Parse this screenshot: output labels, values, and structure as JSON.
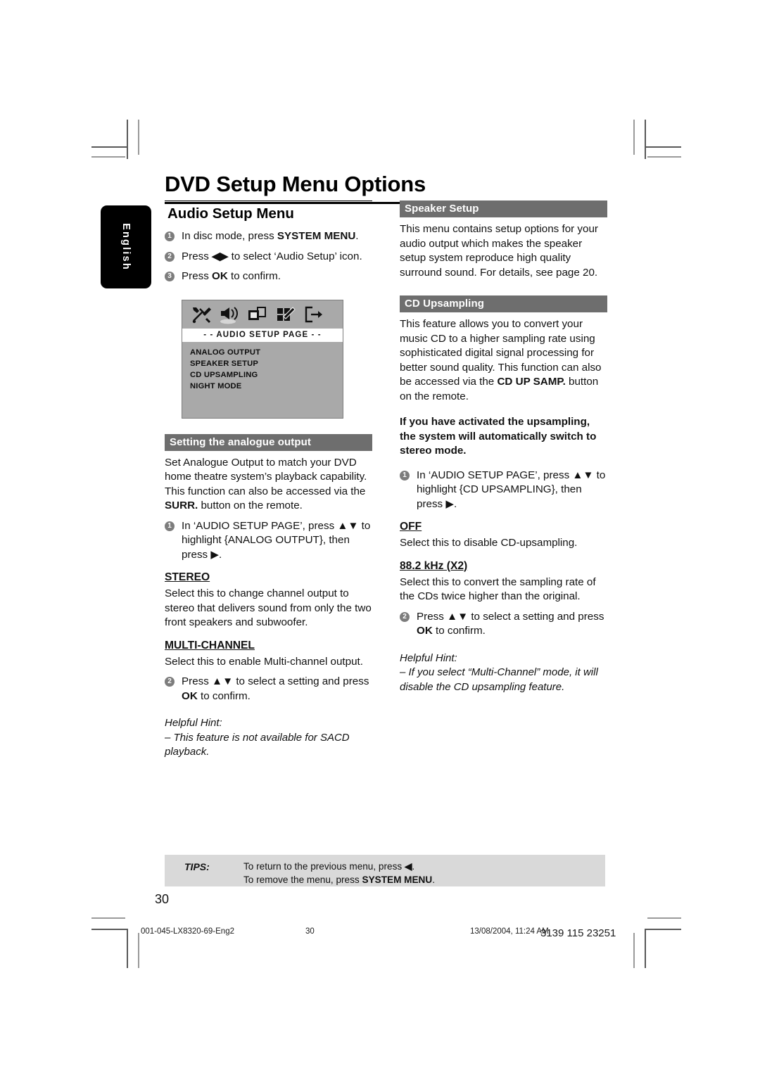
{
  "document": {
    "title": "DVD Setup Menu Options",
    "language_tab": "English",
    "page_number": "30"
  },
  "left_column": {
    "heading": "Audio Setup Menu",
    "steps": [
      {
        "num": "1",
        "text_parts": [
          "In disc mode, press ",
          "SYSTEM MENU",
          "."
        ]
      },
      {
        "num": "2",
        "text_parts": [
          "Press ",
          "◀▶",
          " to select ‘Audio Setup’ icon."
        ]
      },
      {
        "num": "3",
        "text_parts": [
          "Press ",
          "OK",
          " to confirm."
        ]
      }
    ],
    "step1_pre": "In disc mode, press ",
    "step1_bold": "SYSTEM MENU",
    "step1_post": ".",
    "step2_pre": "Press ",
    "step2_arrows": "◀▶",
    "step2_post": " to select ‘Audio Setup’ icon.",
    "step3_pre": "Press ",
    "step3_bold": "OK",
    "step3_post": " to confirm.",
    "tv_screen": {
      "page_bar": "- -  AUDIO  SETUP  PAGE  - -",
      "icons": [
        "tools-icon",
        "speaker-icon",
        "video-icon",
        "picture-grid-icon",
        "exit-icon"
      ],
      "menu_items": [
        "ANALOG OUTPUT",
        "SPEAKER SETUP",
        "CD UPSAMPLING",
        "NIGHT MODE"
      ]
    },
    "analogue_section": {
      "band": "Setting the analogue output",
      "para_pre": "Set Analogue Output to match your DVD home theatre system’s playback capability. This function can also be accessed via the ",
      "para_bold": "SURR.",
      "para_post": " button on the remote.",
      "step1_num": "1",
      "step1_text": "In ‘AUDIO SETUP PAGE’, press ▲▼ to highlight {ANALOG OUTPUT}, then press ▶.",
      "stereo_head": "STEREO",
      "stereo_text": "Select this to change channel output to stereo that delivers sound from only the two front speakers and subwoofer.",
      "multi_head": "MULTI-CHANNEL",
      "multi_text": "Select this to enable Multi-channel output.",
      "step2_num": "2",
      "step2_pre": "Press ▲▼  to select a setting and press ",
      "step2_bold": "OK",
      "step2_post": " to confirm.",
      "hint_label": "Helpful Hint:",
      "hint_text": "–  This feature is not available for SACD playback."
    }
  },
  "right_column": {
    "speaker_setup": {
      "band": "Speaker Setup",
      "text": "This menu contains setup options for your audio output which makes the speaker setup system reproduce high quality surround sound.  For details, see page 20."
    },
    "cd_upsampling": {
      "band": "CD Upsampling",
      "para_pre": "This feature allows you to convert your music CD to a higher sampling rate using sophisticated digital signal processing for better sound quality. This function can also be accessed via the ",
      "para_bold": "CD UP SAMP.",
      "para_post": " button on the remote.",
      "bold_note": "If you have activated the upsampling, the system will automatically switch to stereo mode.",
      "step1_num": "1",
      "step1_text": "In ‘AUDIO SETUP PAGE’, press ▲▼ to highlight {CD UPSAMPLING}, then press ▶.",
      "off_head": "OFF",
      "off_text": "Select this to disable CD-upsampling.",
      "khz_head": "88.2 kHz (X2)",
      "khz_text": "Select this to convert the sampling rate of the CDs twice higher than the original.",
      "step2_num": "2",
      "step2_pre": "Press ▲▼  to select a setting and press ",
      "step2_bold": "OK",
      "step2_post": " to confirm.",
      "hint_label": "Helpful Hint:",
      "hint_text": "–  If you select “Multi-Channel” mode, it will disable the CD upsampling feature."
    }
  },
  "tips": {
    "label": "TIPS:",
    "line1_pre": "To return to the previous menu, press ",
    "line1_arrow": "◀",
    "line1_post": ".",
    "line2_pre": "To remove the menu, press ",
    "line2_bold": "SYSTEM MENU",
    "line2_post": "."
  },
  "print_footer": {
    "file": "001-045-LX8320-69-Eng2",
    "page": "30",
    "date": "13/08/2004, 11:24 AM",
    "code": "3139 115 23251"
  },
  "colors": {
    "band_gray": "#6e6e6e",
    "tips_gray": "#d9d9d9",
    "tv_gray": "#a9a9a9",
    "bullet_gray": "#7d7d7d"
  }
}
